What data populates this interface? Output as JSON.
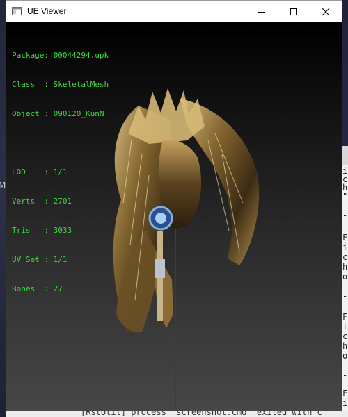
{
  "window": {
    "title": "UE Viewer",
    "controls": {
      "minimize": "minimize",
      "maximize": "maximize",
      "close": "close"
    }
  },
  "info": {
    "package": {
      "label": "Package",
      "value": "00044294.upk"
    },
    "class": {
      "label": "Class  ",
      "value": "SkeletalMesh"
    },
    "object": {
      "label": "Object ",
      "value": "090120_KunN"
    },
    "lod": {
      "label": "LOD    ",
      "value": "1/1"
    },
    "verts": {
      "label": "Verts  ",
      "value": "2701"
    },
    "tris": {
      "label": "Tris   ",
      "value": "3033"
    },
    "uvset": {
      "label": "UV Set ",
      "value": "1/1"
    },
    "bones": {
      "label": "Bones  ",
      "value": "27"
    }
  },
  "background": {
    "left_glyph": "M",
    "right_fragments": [
      "i",
      "c",
      "h",
      "\"",
      "-",
      "F",
      "i",
      "c",
      "h",
      "o",
      "-",
      "F",
      "i",
      "c",
      "h",
      "o",
      "-",
      "F",
      "i"
    ],
    "bottom_text": "[RstUtil] process \"screenshot.cmd\" exited with c"
  },
  "colors": {
    "info_text": "#41d641",
    "axis_line": "#2030d0"
  }
}
